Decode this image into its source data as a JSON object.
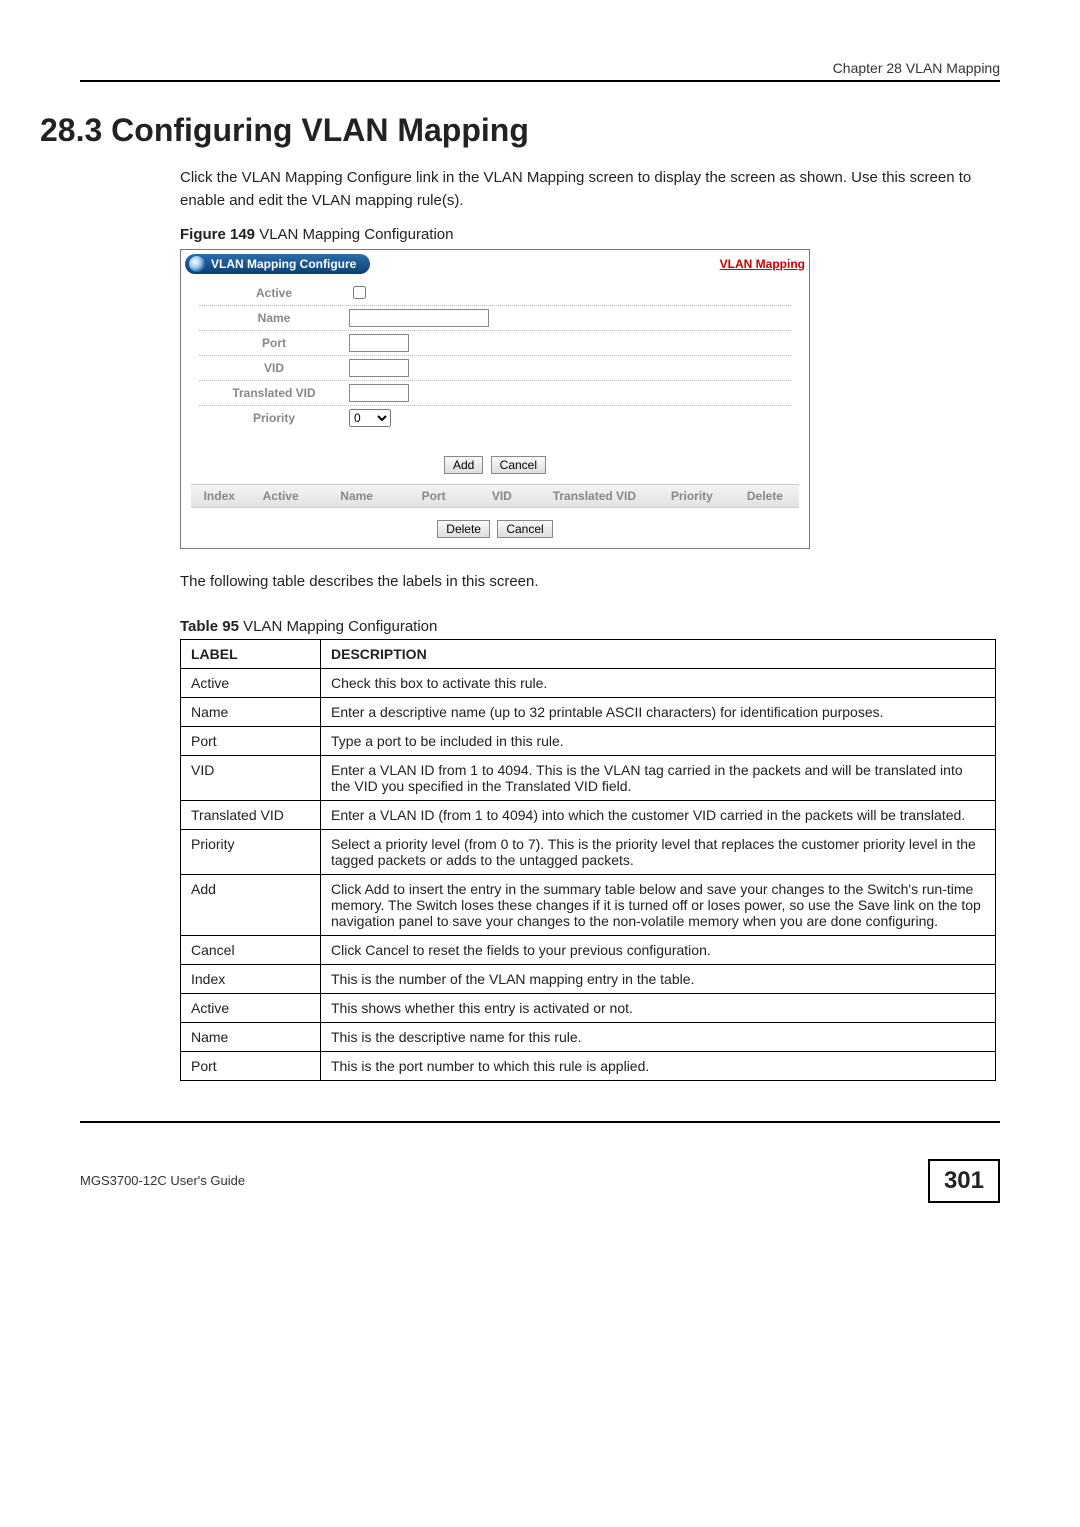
{
  "breadcrumb": "Chapter 28 VLAN Mapping",
  "section_title": "28.3  Configuring VLAN Mapping",
  "intro": "Click the VLAN Mapping Configure link in the VLAN Mapping screen to display the screen as shown. Use this screen to enable and edit the VLAN mapping rule(s).",
  "figure_caption_bold": "Figure 149",
  "figure_caption_rest": "   VLAN Mapping Configuration",
  "ui": {
    "title_pill": "VLAN Mapping Configure",
    "headlink": "VLAN Mapping",
    "rows": {
      "active": "Active",
      "name": "Name",
      "port": "Port",
      "vid": "VID",
      "tvid": "Translated VID",
      "priority": "Priority",
      "priority_value": "0"
    },
    "add_btn": "Add",
    "cancel_btn": "Cancel",
    "list_cols": {
      "index": "Index",
      "active": "Active",
      "name": "Name",
      "port": "Port",
      "vid": "VID",
      "tvid": "Translated VID",
      "priority": "Priority",
      "delete": "Delete"
    },
    "delete_btn": "Delete",
    "cancel_btn2": "Cancel"
  },
  "middle_text": "The following table describes the labels in this screen.",
  "table_caption_bold": "Table 95",
  "table_caption_rest": "   VLAN Mapping Configuration",
  "table_head": {
    "label": "LABEL",
    "desc": "DESCRIPTION"
  },
  "table_rows": [
    {
      "label": "Active",
      "desc": "Check this box to activate this rule."
    },
    {
      "label": "Name",
      "desc": "Enter a descriptive name (up to 32 printable ASCII characters) for identification purposes."
    },
    {
      "label": "Port",
      "desc": "Type a port to be included in this rule."
    },
    {
      "label": "VID",
      "desc": "Enter a VLAN ID from 1 to 4094. This is the VLAN tag carried in the packets and will be translated into the VID you specified in the Translated VID field."
    },
    {
      "label": "Translated VID",
      "desc": "Enter a VLAN ID (from 1 to 4094) into which the customer VID carried in the packets will be translated."
    },
    {
      "label": "Priority",
      "desc": "Select a priority level (from 0 to 7). This is the priority level that replaces the customer priority level in the tagged packets or adds to the untagged packets."
    },
    {
      "label": "Add",
      "desc": "Click Add to insert the entry in the summary table below and save your changes to the Switch's run-time memory. The Switch loses these changes if it is turned off or loses power, so use the Save link on the top navigation panel to save your changes to the non-volatile memory when you are done configuring."
    },
    {
      "label": "Cancel",
      "desc": "Click Cancel to reset the fields to your previous configuration."
    },
    {
      "label": "Index",
      "desc": "This is the number of the VLAN mapping entry in the table."
    },
    {
      "label": "Active",
      "desc": "This shows whether this entry is activated or not."
    },
    {
      "label": "Name",
      "desc": "This is the descriptive name for this rule."
    },
    {
      "label": "Port",
      "desc": "This is the port number to which this rule is applied."
    }
  ],
  "footer_left": "MGS3700-12C User's Guide",
  "page_number": "301"
}
